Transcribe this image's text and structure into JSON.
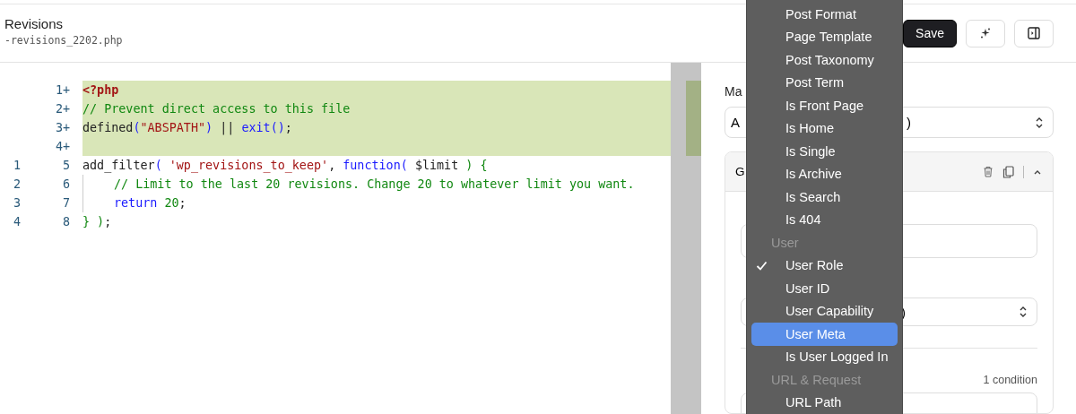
{
  "header": {
    "title": "Revisions",
    "filename": "-revisions_2202.php",
    "buttons": [
      {
        "kind": "save",
        "label": "Save"
      },
      {
        "kind": "sparkle"
      },
      {
        "kind": "panel"
      }
    ]
  },
  "diff": {
    "lines": [
      {
        "new": "1+",
        "added": true,
        "indent": false,
        "tokens": [
          {
            "t": "<?php",
            "kind": "tag"
          }
        ]
      },
      {
        "new": "2+",
        "added": true,
        "indent": false,
        "tokens": [
          {
            "t": "// Prevent direct access to this file",
            "kind": "comment"
          }
        ]
      },
      {
        "new": "3+",
        "added": true,
        "indent": false,
        "tokens": [
          {
            "t": "defined",
            "kind": "plain"
          },
          {
            "t": "(",
            "kind": "keyword"
          },
          {
            "t": "\"ABSPATH\"",
            "kind": "string"
          },
          {
            "t": ")",
            "kind": "keyword"
          },
          {
            "t": " || ",
            "kind": "plain"
          },
          {
            "t": "exit",
            "kind": "keyword"
          },
          {
            "t": "()",
            "kind": "keyword"
          },
          {
            "t": ";",
            "kind": "plain"
          }
        ]
      },
      {
        "new": "4+",
        "added": true,
        "indent": false
      },
      {
        "old": "1",
        "new": "5",
        "added": false,
        "indent": false,
        "tokens": [
          {
            "t": "add_filter",
            "kind": "plain"
          },
          {
            "t": "( ",
            "kind": "keyword"
          },
          {
            "t": "'wp_revisions_to_keep'",
            "kind": "string"
          },
          {
            "t": ", ",
            "kind": "plain"
          },
          {
            "t": "function",
            "kind": "keyword"
          },
          {
            "t": "( ",
            "kind": "keyword"
          },
          {
            "t": "$limit ",
            "kind": "plain"
          },
          {
            "t": ") {",
            "kind": "comment"
          }
        ]
      },
      {
        "old": "2",
        "new": "6",
        "added": false,
        "indent": true,
        "tokens": [
          {
            "t": "// Limit to the last 20 revisions. Change 20 to whatever limit you want.",
            "kind": "comment"
          }
        ]
      },
      {
        "old": "3",
        "new": "7",
        "added": false,
        "indent": true,
        "tokens": [
          {
            "t": "return",
            "kind": "keyword"
          },
          {
            "t": " 20",
            "kind": "comment"
          },
          {
            "t": ";",
            "kind": "plain"
          }
        ]
      },
      {
        "old": "4",
        "new": "8",
        "added": false,
        "indent": false,
        "tokens": [
          {
            "t": "} )",
            "kind": "comment"
          },
          {
            "t": ";",
            "kind": "plain"
          }
        ]
      }
    ]
  },
  "panel": {
    "match_label": "Ma",
    "match_select": {
      "left": "A",
      "right": ")"
    },
    "group": {
      "title": "G",
      "field_2_select": ")",
      "condition_count": "1 condition"
    }
  },
  "menu": {
    "items": [
      {
        "kind": "item",
        "label": "Post Format",
        "checked": false,
        "selected": false
      },
      {
        "kind": "item",
        "label": "Page Template",
        "checked": false,
        "selected": false
      },
      {
        "kind": "item",
        "label": "Post Taxonomy",
        "checked": false,
        "selected": false
      },
      {
        "kind": "item",
        "label": "Post Term",
        "checked": false,
        "selected": false
      },
      {
        "kind": "item",
        "label": "Is Front Page",
        "checked": false,
        "selected": false
      },
      {
        "kind": "item",
        "label": "Is Home",
        "checked": false,
        "selected": false
      },
      {
        "kind": "item",
        "label": "Is Single",
        "checked": false,
        "selected": false
      },
      {
        "kind": "item",
        "label": "Is Archive",
        "checked": false,
        "selected": false
      },
      {
        "kind": "item",
        "label": "Is Search",
        "checked": false,
        "selected": false
      },
      {
        "kind": "item",
        "label": "Is 404",
        "checked": false,
        "selected": false
      },
      {
        "kind": "header",
        "label": "User"
      },
      {
        "kind": "item",
        "label": "User Role",
        "checked": true,
        "selected": false
      },
      {
        "kind": "item",
        "label": "User ID",
        "checked": false,
        "selected": false
      },
      {
        "kind": "item",
        "label": "User Capability",
        "checked": false,
        "selected": false
      },
      {
        "kind": "item",
        "label": "User Meta",
        "checked": false,
        "selected": true
      },
      {
        "kind": "item",
        "label": "Is User Logged In",
        "checked": false,
        "selected": false
      },
      {
        "kind": "header",
        "label": "URL & Request"
      },
      {
        "kind": "item",
        "label": "URL Path",
        "checked": false,
        "selected": false
      }
    ]
  }
}
